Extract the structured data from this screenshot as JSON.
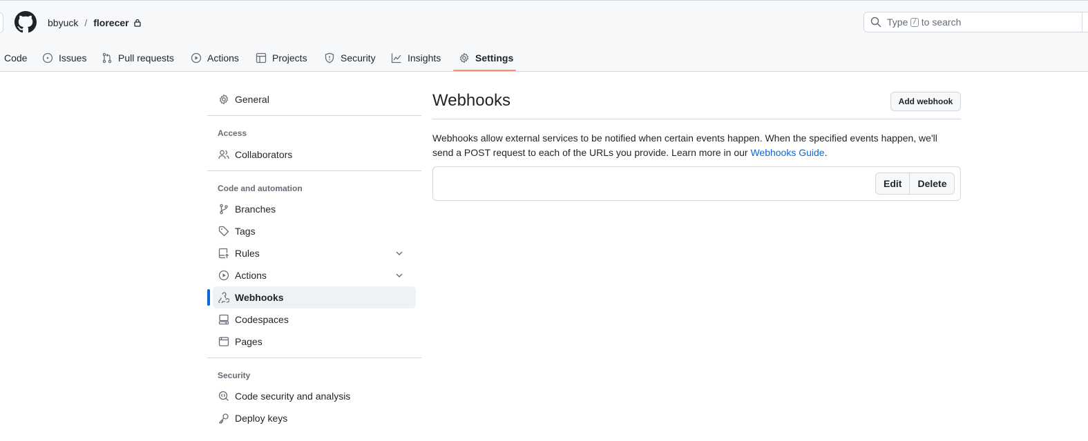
{
  "header": {
    "owner": "bbyuck",
    "separator": "/",
    "repo": "florecer",
    "search": {
      "prefix": "Type",
      "key": "/",
      "suffix": "to search"
    }
  },
  "tabs": [
    {
      "label": "Code",
      "icon": "code-icon"
    },
    {
      "label": "Issues",
      "icon": "issue-icon"
    },
    {
      "label": "Pull requests",
      "icon": "pull-request-icon"
    },
    {
      "label": "Actions",
      "icon": "play-icon"
    },
    {
      "label": "Projects",
      "icon": "table-icon"
    },
    {
      "label": "Security",
      "icon": "shield-icon"
    },
    {
      "label": "Insights",
      "icon": "graph-icon"
    },
    {
      "label": "Settings",
      "icon": "gear-icon",
      "active": true
    }
  ],
  "sidebar": {
    "general": "General",
    "access_heading": "Access",
    "collaborators": "Collaborators",
    "code_heading": "Code and automation",
    "branches": "Branches",
    "tags": "Tags",
    "rules": "Rules",
    "actions": "Actions",
    "webhooks": "Webhooks",
    "codespaces": "Codespaces",
    "pages": "Pages",
    "security_heading": "Security",
    "code_security": "Code security and analysis",
    "deploy_keys": "Deploy keys"
  },
  "main": {
    "title": "Webhooks",
    "add_button": "Add webhook",
    "description": "Webhooks allow external services to be notified when certain events happen. When the specified events happen, we'll send a POST request to each of the URLs you provide. Learn more in our ",
    "guide_link": "Webhooks Guide",
    "period": ".",
    "edit_button": "Edit",
    "delete_button": "Delete"
  },
  "colors": {
    "accent": "#0969da",
    "tab_underline": "#fd8c73",
    "border": "#d0d7de"
  }
}
